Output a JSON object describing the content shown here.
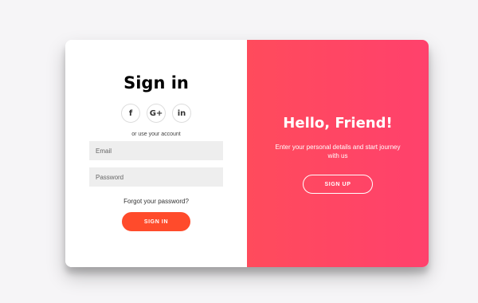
{
  "sign_in": {
    "title": "Sign in",
    "socials": [
      {
        "label": "f",
        "icon": "facebook-icon"
      },
      {
        "label": "G+",
        "icon": "google-plus-icon"
      },
      {
        "label": "in",
        "icon": "linkedin-icon"
      }
    ],
    "alt_text": "or use your account",
    "email_placeholder": "Email",
    "password_placeholder": "Password",
    "forgot_text": "Forgot your password?",
    "button_label": "SIGN IN"
  },
  "overlay": {
    "title": "Hello, Friend!",
    "description": "Enter your personal details and start journey with us",
    "button_label": "SIGN UP"
  },
  "colors": {
    "accent": "#ff4b2b",
    "gradient_start": "#ff4b5c",
    "gradient_end": "#ff416c",
    "field_bg": "#eeeeee"
  }
}
